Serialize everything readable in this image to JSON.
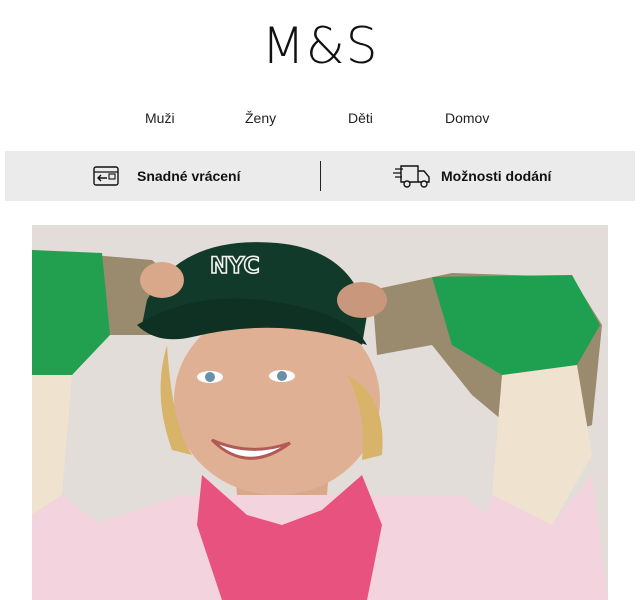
{
  "brand": {
    "logo_text": "M&S"
  },
  "nav": {
    "items": [
      {
        "label": "Muži"
      },
      {
        "label": "Ženy"
      },
      {
        "label": "Děti"
      },
      {
        "label": "Domov"
      }
    ]
  },
  "benefits": {
    "returns": {
      "label": "Snadné vrácení",
      "icon": "return-box-icon"
    },
    "delivery": {
      "label": "Možnosti dodání",
      "icon": "delivery-truck-icon"
    }
  },
  "hero": {
    "cap_text": "NYC"
  },
  "colors": {
    "benefit_bar_bg": "#ebebeb",
    "hero_bg": "#e2ddd8",
    "cap_green": "#123a2a",
    "sleeve_green": "#1fa050",
    "scarf_pink": "#e8527e",
    "sweater_pink": "#f2d3de"
  }
}
